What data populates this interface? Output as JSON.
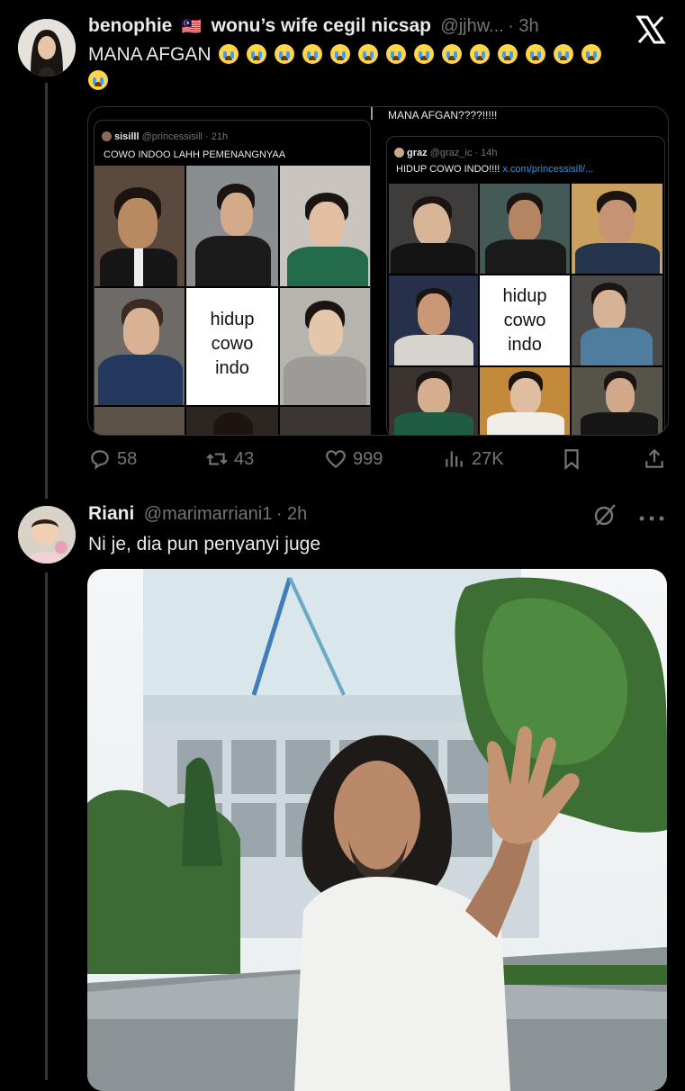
{
  "tweet1": {
    "name": "benophie",
    "flag": "🇲🇾",
    "display_suffix": "wonu’s wife cegil nicsap",
    "handle": "@jjhw...",
    "time": "· 3h",
    "text": "MANA AFGAN",
    "emoji_count_line1": 14,
    "emoji_count_line2": 1,
    "media_right_caption": "MANA AFGAN????!!!!!",
    "qt_left": {
      "name": "sisilll",
      "handle": "@princessisill · 21h",
      "text": "COWO INDOO LAHH PEMENANGNYAA",
      "label": [
        "hidup",
        "cowo",
        "indo"
      ]
    },
    "qt_right": {
      "name": "graz",
      "handle": "@graz_ic · 14h",
      "text": "HIDUP COWO INDO!!!!",
      "link": "x.com/princessisill/...",
      "label": [
        "hidup",
        "cowo",
        "indo"
      ]
    },
    "actions": {
      "replies": "58",
      "retweets": "43",
      "likes": "999",
      "views": "27K"
    }
  },
  "tweet2": {
    "name": "Riani",
    "handle": "@marimarriani1",
    "time": "· 2h",
    "text": "Ni je, dia pun penyanyi juge"
  },
  "icons": {
    "x_logo": "x-logo-icon",
    "reply": "reply-icon",
    "retweet": "retweet-icon",
    "like": "heart-icon",
    "views": "views-icon",
    "bookmark": "bookmark-icon",
    "share": "share-icon",
    "grok": "grok-icon",
    "more": "more-icon"
  },
  "colors": {
    "background": "#000000",
    "text": "#e7e9ea",
    "muted": "#71767b",
    "link": "#1d9bf0",
    "border": "#2f3336"
  }
}
